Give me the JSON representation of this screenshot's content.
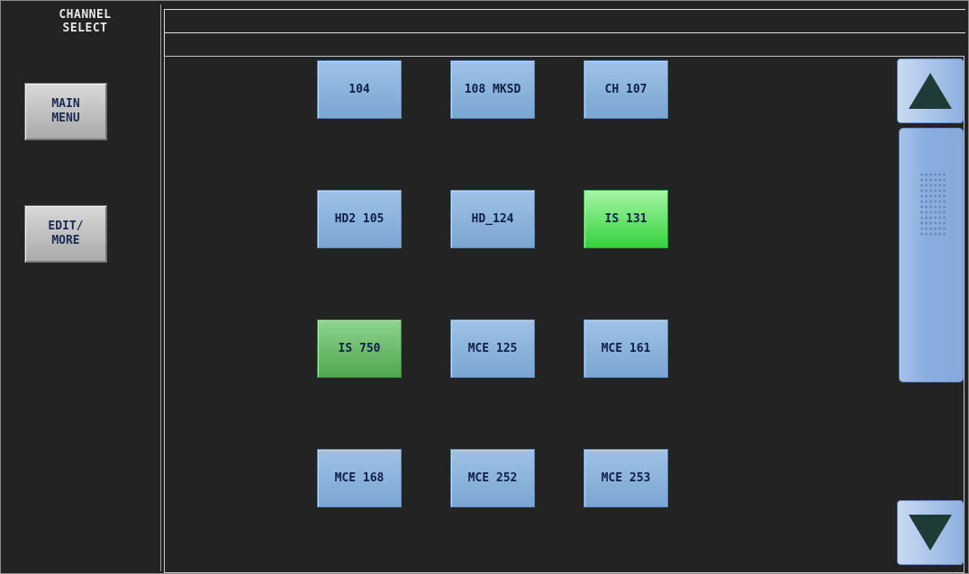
{
  "window": {
    "title": "CHANNEL\nSELECT"
  },
  "sidebar": {
    "main_menu_label": "MAIN\nMENU",
    "edit_more_label": "EDIT/\nMORE"
  },
  "channels": [
    {
      "label": "104",
      "state": "normal"
    },
    {
      "label": "108 MKSD",
      "state": "normal"
    },
    {
      "label": "CH 107",
      "state": "normal"
    },
    {
      "label": "HD2 105",
      "state": "normal"
    },
    {
      "label": "HD_124",
      "state": "normal"
    },
    {
      "label": "IS 131",
      "state": "selected-bright"
    },
    {
      "label": "IS 750",
      "state": "selected-dim"
    },
    {
      "label": "MCE 125",
      "state": "normal"
    },
    {
      "label": "MCE 161",
      "state": "normal"
    },
    {
      "label": "MCE 168",
      "state": "normal"
    },
    {
      "label": "MCE 252",
      "state": "normal"
    },
    {
      "label": "MCE 253",
      "state": "normal"
    }
  ],
  "scrollbar": {
    "up_icon": "triangle-up-icon",
    "down_icon": "triangle-down-icon",
    "grip_icon": "grip-dots-icon"
  },
  "colors": {
    "background": "#232323",
    "button_blue": "#8fb6dd",
    "selected_bright_green": "#3ed646",
    "selected_dim_green": "#5fb35f",
    "label_text": "#0f1f46"
  }
}
